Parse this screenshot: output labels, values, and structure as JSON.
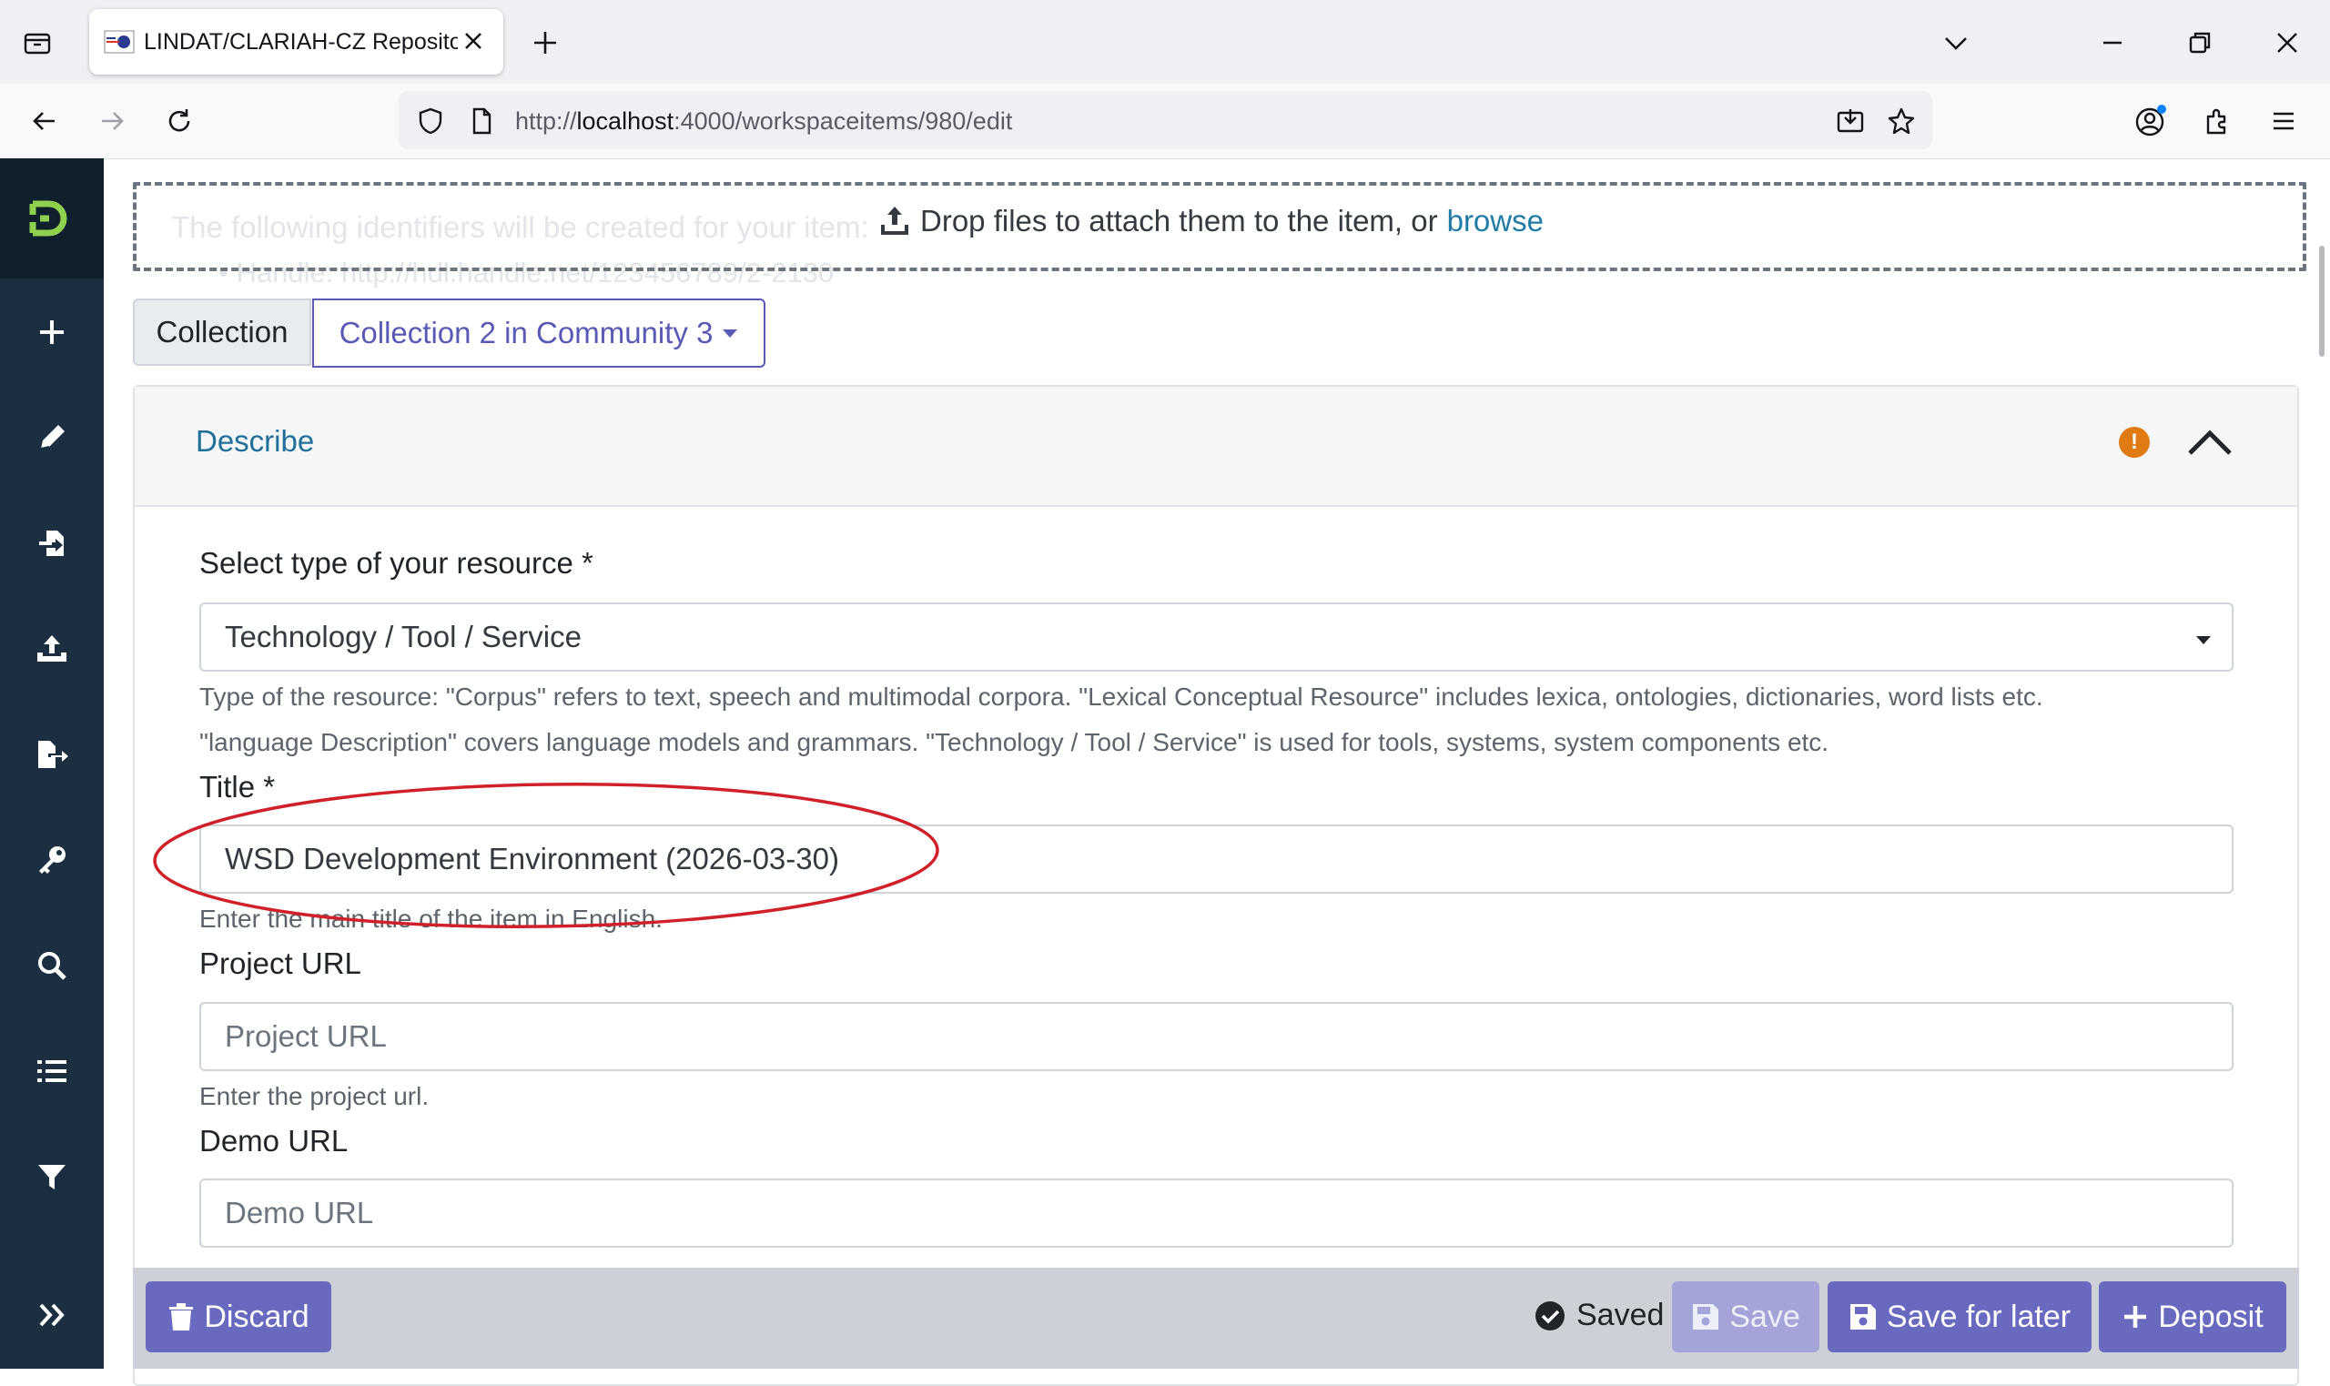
{
  "browser": {
    "tab_title": "LINDAT/CLARIAH-CZ Repository",
    "url_scheme": "http://",
    "url_host": "localhost",
    "url_path": ":4000/workspaceitems/980/edit",
    "icons": [
      "tab-list-icon",
      "new-tab-icon",
      "tab-overflow-icon",
      "minimize-icon",
      "restore-icon",
      "window-close-icon",
      "back-icon",
      "forward-icon",
      "reload-icon",
      "shield-icon",
      "page-icon",
      "download-icon",
      "star-icon",
      "account-icon",
      "extensions-icon",
      "menu-icon"
    ]
  },
  "sidebar": {
    "items": [
      "logo-icon",
      "plus-icon",
      "pencil-icon",
      "import-icon",
      "upload-icon",
      "export-icon",
      "key-icon",
      "search-icon",
      "list-icon",
      "filter-icon",
      "expand-icon"
    ]
  },
  "upload": {
    "drop_text": "Drop files to attach them to the item, or",
    "browse_link": "browse",
    "ghost_line1": "The following identifiers will be created for your item:",
    "ghost_line2": "• Handle: http://hdl.handle.net/123456789/2-2130"
  },
  "collection": {
    "label": "Collection",
    "value": "Collection 2 in Community 3"
  },
  "section": {
    "title": "Describe",
    "warning": "!"
  },
  "form": {
    "type_label": "Select type of your resource *",
    "type_value": "Technology / Tool / Service",
    "type_hint1": "Type of the resource: \"Corpus\" refers to text, speech and multimodal corpora. \"Lexical Conceptual Resource\" includes lexica, ontologies, dictionaries, word lists etc.",
    "type_hint2": "\"language Description\" covers language models and grammars. \"Technology / Tool / Service\" is used for tools, systems, system components etc.",
    "title_label": "Title *",
    "title_value": "WSD Development Environment (2026-03-30)",
    "title_hint": "Enter the main title of the item in English.",
    "project_label": "Project URL",
    "project_placeholder": "Project URL",
    "project_hint": "Enter the project url.",
    "demo_label": "Demo URL",
    "demo_placeholder": "Demo URL"
  },
  "footer": {
    "discard": "Discard",
    "saved": "Saved",
    "save": "Save",
    "save_later": "Save for later",
    "deposit": "Deposit"
  },
  "colors": {
    "primary": "#6a69c0",
    "sidebar": "#1b2f40",
    "logo_green": "#8fd14f",
    "link": "#1f6f98",
    "warning": "#e07a12",
    "annotation": "#d0202a"
  }
}
